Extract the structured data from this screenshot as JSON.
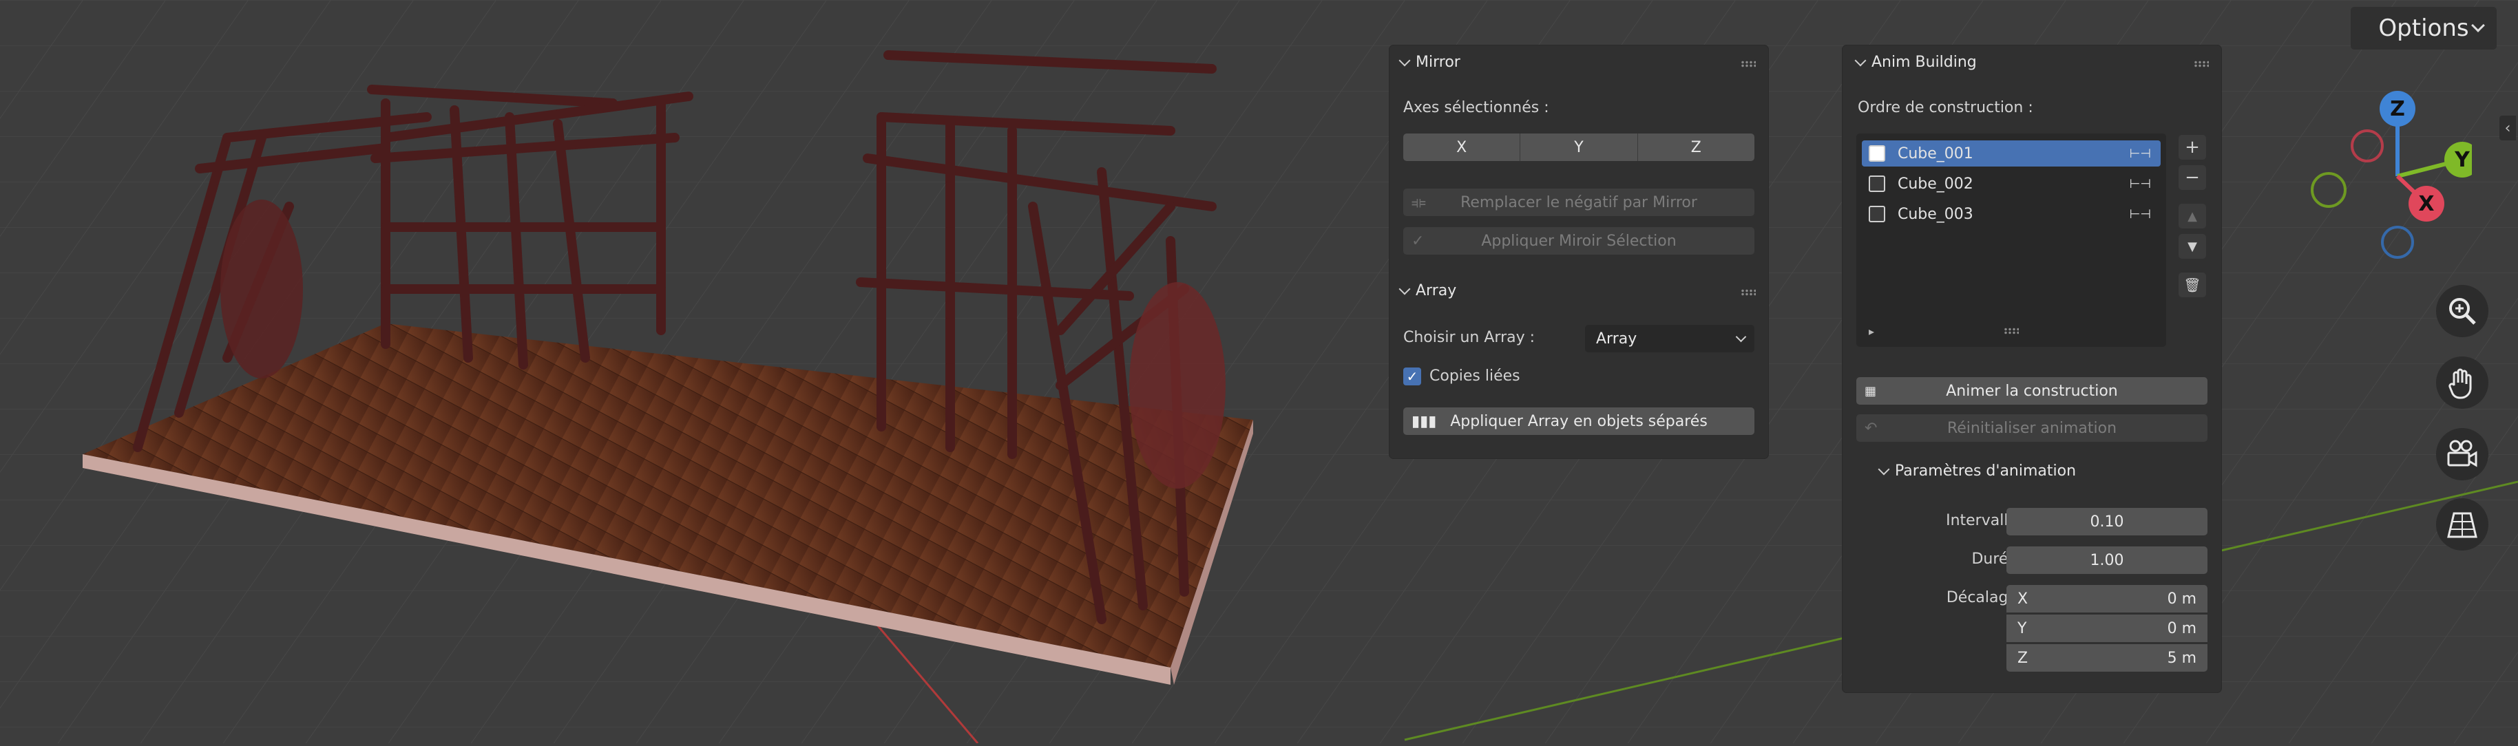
{
  "header": {
    "options_label": "Options"
  },
  "mirror": {
    "title": "Mirror",
    "axes_label": "Axes sélectionnés :",
    "axes": [
      "X",
      "Y",
      "Z"
    ],
    "replace_negative_label": "Remplacer le négatif par Mirror",
    "apply_label": "Appliquer Miroir Sélection"
  },
  "array": {
    "title": "Array",
    "choose_label": "Choisir un Array :",
    "selected_value": "Array",
    "linked_copies_label": "Copies liées",
    "linked_copies_checked": true,
    "apply_label": "Appliquer Array en objets séparés"
  },
  "anim": {
    "title": "Anim Building",
    "order_label": "Ordre de construction :",
    "items": [
      {
        "name": "Cube_001",
        "selected": true
      },
      {
        "name": "Cube_002",
        "selected": false
      },
      {
        "name": "Cube_003",
        "selected": false
      }
    ],
    "animate_label": "Animer la construction",
    "reset_label": "Réinitialiser animation",
    "params_title": "Paramètres d'animation",
    "interval_label": "Intervalle",
    "interval_value": "0.10",
    "duration_label": "Durée",
    "duration_value": "1.00",
    "offset_label": "Décalage",
    "offset": [
      {
        "axis": "X",
        "value": "0 m"
      },
      {
        "axis": "Y",
        "value": "0 m"
      },
      {
        "axis": "Z",
        "value": "5 m"
      }
    ]
  },
  "gizmo": {
    "x": "X",
    "y": "Y",
    "z": "Z"
  },
  "colors": {
    "x_axis": "#e0475b",
    "y_axis": "#7fb928",
    "z_axis": "#3f84d6",
    "selection": "#4772b3"
  }
}
